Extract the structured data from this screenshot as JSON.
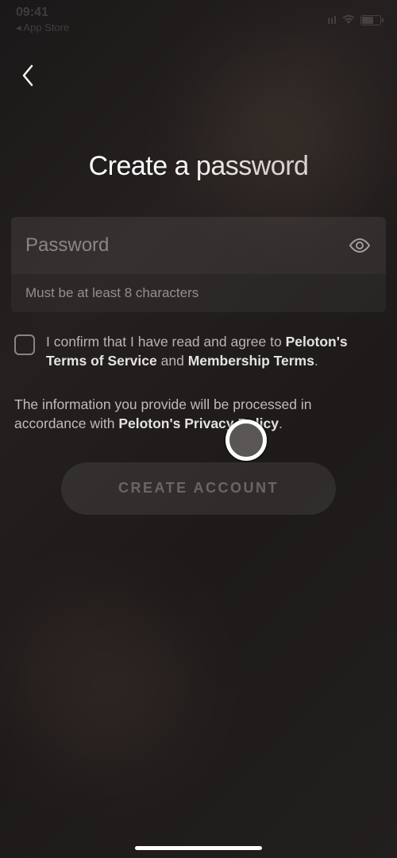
{
  "statusBar": {
    "time": "09:41",
    "backToApp": "◂ App Store"
  },
  "page": {
    "title": "Create a password"
  },
  "password": {
    "placeholder": "Password",
    "hint": "Must be at least 8 characters"
  },
  "terms": {
    "prefix": "I confirm that I have read and agree to ",
    "tosLink": "Peloton's Terms of Service",
    "middle": " and ",
    "membershipLink": "Membership Terms",
    "suffix": "."
  },
  "privacy": {
    "prefix": "The information you provide will be processed in accordance with ",
    "policyLink": "Peloton's Privacy Policy",
    "suffix": "."
  },
  "button": {
    "createLabel": "CREATE ACCOUNT"
  }
}
